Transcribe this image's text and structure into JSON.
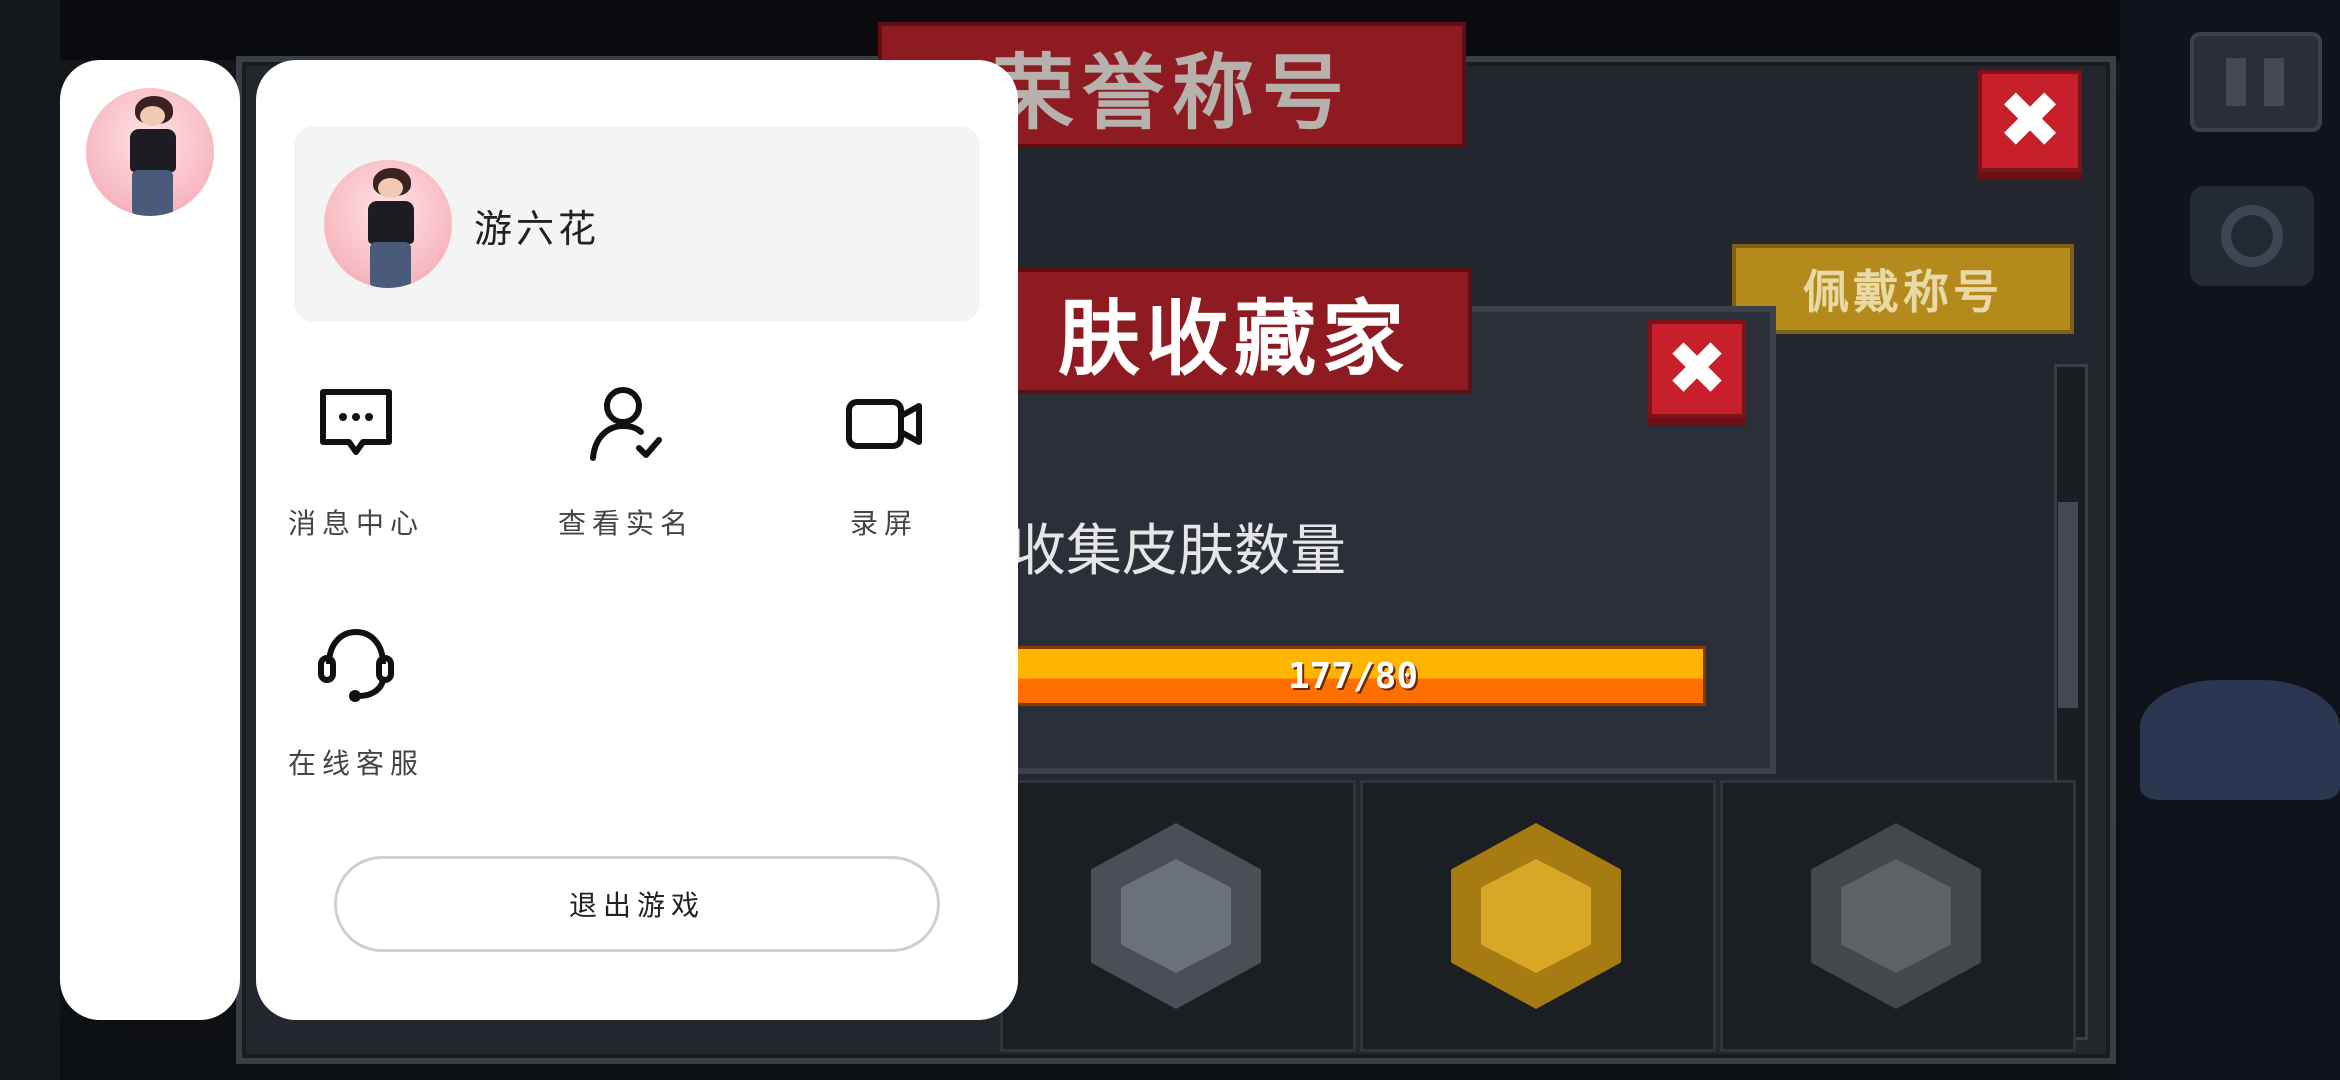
{
  "game": {
    "honor_panel": {
      "title": "荣誉称号",
      "wear_button_label": "佩戴称号",
      "close_symbol": "✖"
    },
    "skin_panel": {
      "title": "肤收藏家",
      "label": "收集皮肤数量",
      "progress_text": "177/80",
      "progress_fraction": 1.0,
      "close_symbol": "✖"
    },
    "badges": [
      {
        "icon": "helmet-badge-icon",
        "color": "#6b7178"
      },
      {
        "icon": "book-badge-icon",
        "color": "#d9a726"
      },
      {
        "icon": "cat-badge-icon",
        "color": "#5e6166"
      }
    ]
  },
  "overlay_menu": {
    "profile": {
      "name": "游六花"
    },
    "items": [
      {
        "label": "消息中心",
        "icon": "message-icon"
      },
      {
        "label": "查看实名",
        "icon": "user-verify-icon"
      },
      {
        "label": "录屏",
        "icon": "video-camera-icon"
      },
      {
        "label": "在线客服",
        "icon": "headset-icon"
      }
    ],
    "exit_label": "退出游戏"
  },
  "colors": {
    "banner_red": "#8f1b22",
    "close_red": "#c8202b",
    "wear_gold": "#b48a1d",
    "progress_orange": "#ff7a00",
    "progress_yellow": "#ffb400"
  }
}
